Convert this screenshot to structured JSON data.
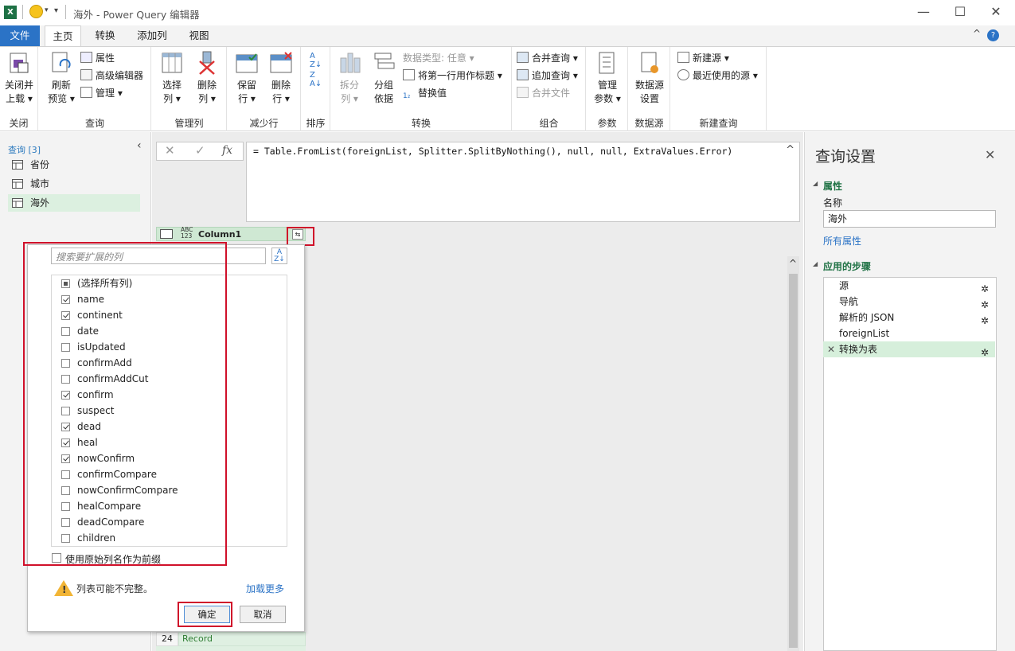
{
  "window": {
    "title": "海外 - Power Query 编辑器",
    "minimize": "—",
    "maximize": "☐",
    "close": "✕"
  },
  "tabs": {
    "file": "文件",
    "home": "主页",
    "transform": "转换",
    "add_column": "添加列",
    "view": "视图"
  },
  "ribbon": {
    "close_group": {
      "label": "关闭",
      "close_load_l1": "关闭并",
      "close_load_l2": "上载"
    },
    "query_group": {
      "label": "查询",
      "refresh_l1": "刷新",
      "refresh_l2": "预览",
      "properties": "属性",
      "advanced_editor": "高级编辑器",
      "manage": "管理"
    },
    "manage_cols_group": {
      "label": "管理列",
      "choose_l1": "选择",
      "choose_l2": "列",
      "remove_l1": "删除",
      "remove_l2": "列"
    },
    "reduce_rows_group": {
      "label": "减少行",
      "keep_l1": "保留",
      "keep_l2": "行",
      "remove_l1": "删除",
      "remove_l2": "行"
    },
    "sort_group": {
      "label": "排序"
    },
    "transform_group": {
      "label": "转换",
      "split_l1": "拆分",
      "split_l2": "列",
      "group_l1": "分组",
      "group_l2": "依据",
      "data_type": "数据类型: 任意",
      "first_row_header": "将第一行用作标题",
      "replace_values": "替换值"
    },
    "combine_group": {
      "label": "组合",
      "merge": "合并查询",
      "append": "追加查询",
      "combine_files": "合并文件"
    },
    "params_group": {
      "label": "参数",
      "manage_l1": "管理",
      "manage_l2": "参数"
    },
    "datasource_group": {
      "label": "数据源",
      "settings_l1": "数据源",
      "settings_l2": "设置"
    },
    "newquery_group": {
      "label": "新建查询",
      "new_source": "新建源",
      "recent_sources": "最近使用的源"
    }
  },
  "left_panel": {
    "header": "查询 [3]",
    "items": [
      "省份",
      "城市",
      "海外"
    ]
  },
  "formula_bar": {
    "cancel": "✕",
    "confirm": "✓",
    "fx": "fx",
    "formula": "= Table.FromList(foreignList, Splitter.SplitByNothing(), null, null, ExtraValues.Error)"
  },
  "grid": {
    "type_label_top": "ABC",
    "type_label_bottom": "123",
    "column_name": "Column1",
    "row_number": "24",
    "row_value": "Record"
  },
  "expand_popup": {
    "search_placeholder": "搜索要扩展的列",
    "select_all": "(选择所有列)",
    "columns": [
      {
        "name": "name",
        "checked": true
      },
      {
        "name": "continent",
        "checked": true
      },
      {
        "name": "date",
        "checked": false
      },
      {
        "name": "isUpdated",
        "checked": false
      },
      {
        "name": "confirmAdd",
        "checked": false
      },
      {
        "name": "confirmAddCut",
        "checked": false
      },
      {
        "name": "confirm",
        "checked": true
      },
      {
        "name": "suspect",
        "checked": false
      },
      {
        "name": "dead",
        "checked": true
      },
      {
        "name": "heal",
        "checked": true
      },
      {
        "name": "nowConfirm",
        "checked": true
      },
      {
        "name": "confirmCompare",
        "checked": false
      },
      {
        "name": "nowConfirmCompare",
        "checked": false
      },
      {
        "name": "healCompare",
        "checked": false
      },
      {
        "name": "deadCompare",
        "checked": false
      },
      {
        "name": "children",
        "checked": false
      }
    ],
    "prefix_option": "使用原始列名作为前缀",
    "warning": "列表可能不完整。",
    "load_more": "加载更多",
    "ok": "确定",
    "cancel": "取消"
  },
  "right_panel": {
    "title": "查询设置",
    "close": "✕",
    "properties_header": "属性",
    "name_label": "名称",
    "name_value": "海外",
    "all_properties": "所有属性",
    "steps_header": "应用的步骤",
    "steps": [
      "源",
      "导航",
      "解析的 JSON",
      "foreignList",
      "转换为表"
    ]
  },
  "colors": {
    "accent": "#2b73c6",
    "green": "#217346",
    "highlight": "#d0102a"
  }
}
